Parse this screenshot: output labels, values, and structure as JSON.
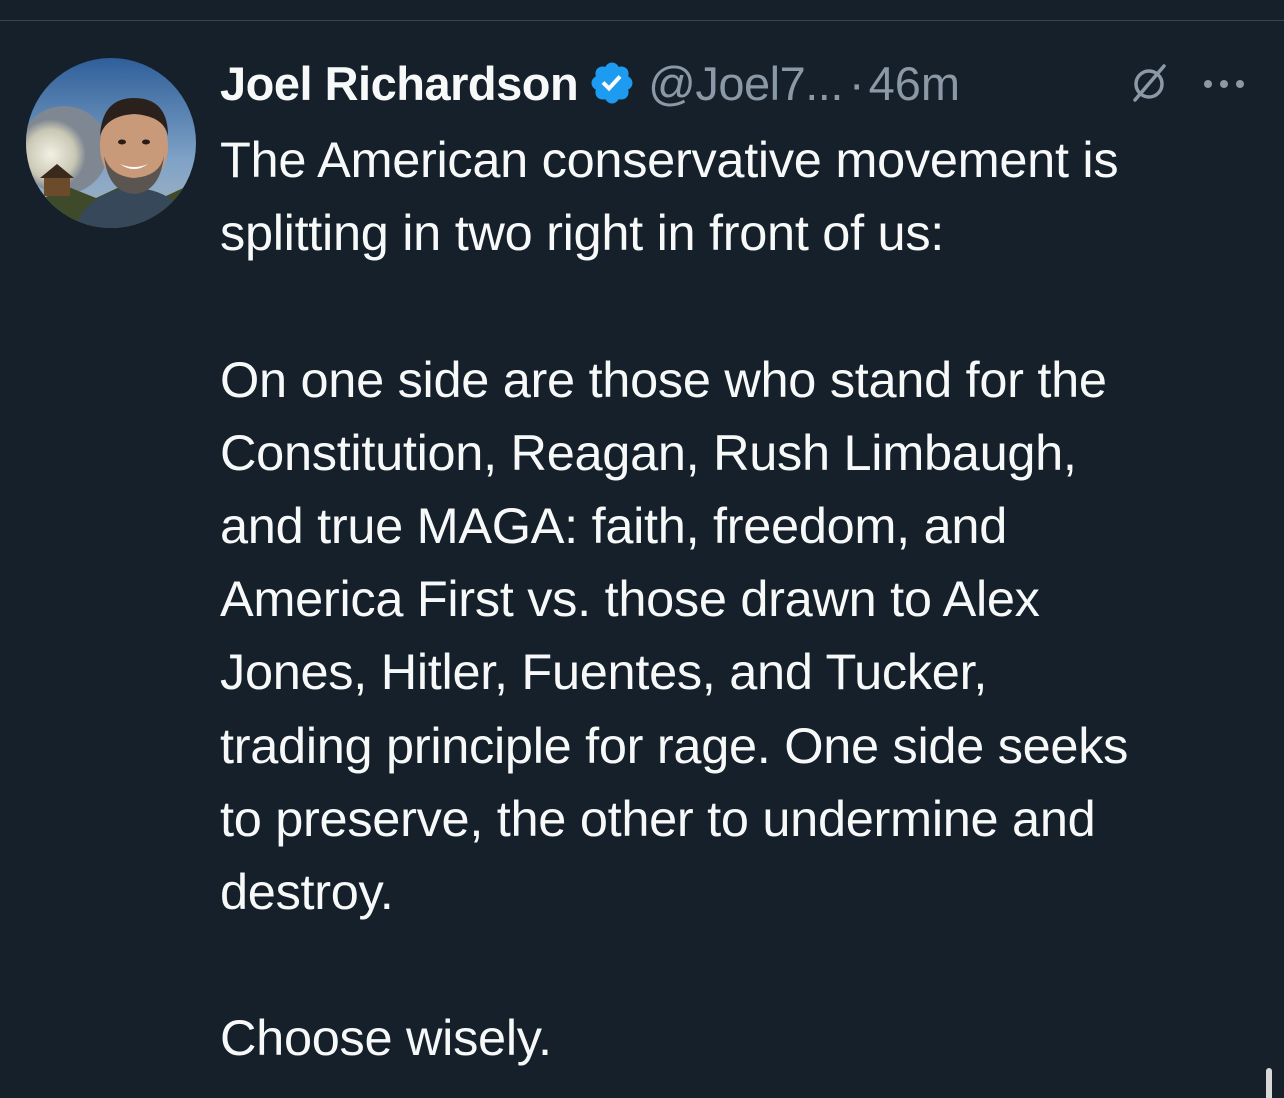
{
  "tweet": {
    "author_name": "Joel Richardson",
    "handle": "@Joel7...",
    "separator": "·",
    "time": "46m",
    "verified": true,
    "icons": {
      "avatar": "avatar-image",
      "verified": "verified-badge-icon",
      "grok": "grok-icon",
      "more": "more-options-icon"
    },
    "colors": {
      "background": "#15202b",
      "text": "#f7f9f9",
      "secondary_text": "#8b98a5",
      "verified_blue": "#1d9bf0"
    },
    "lines": [
      "The American conservative movement is",
      "splitting in two right in front of us:",
      "",
      "On one side are those who stand for the",
      "Constitution, Reagan, Rush Limbaugh,",
      "and true MAGA: faith, freedom, and",
      "America First vs. those drawn to Alex",
      "Jones, Hitler, Fuentes, and Tucker,",
      "trading principle for rage. One side seeks",
      "to preserve, the other to undermine and",
      "destroy.",
      "",
      "Choose wisely."
    ]
  }
}
